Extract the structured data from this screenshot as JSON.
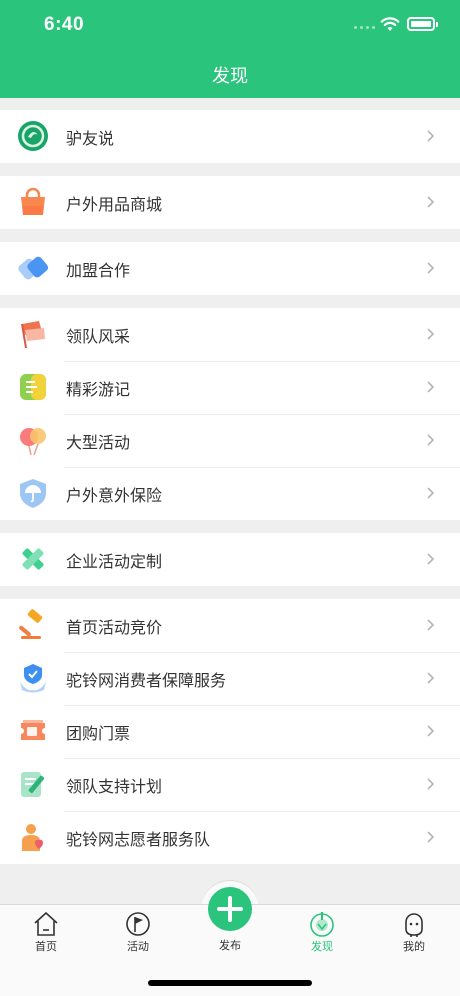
{
  "status": {
    "time": "6:40"
  },
  "header": {
    "title": "发现"
  },
  "sections": [
    {
      "items": [
        {
          "label": "驴友说",
          "icon": "lvyoushuo-icon"
        }
      ]
    },
    {
      "items": [
        {
          "label": "户外用品商城",
          "icon": "shopping-bag-icon"
        }
      ]
    },
    {
      "items": [
        {
          "label": "加盟合作",
          "icon": "join-icon"
        }
      ]
    },
    {
      "items": [
        {
          "label": "领队风采",
          "icon": "flag-icon"
        },
        {
          "label": "精彩游记",
          "icon": "notes-icon"
        },
        {
          "label": "大型活动",
          "icon": "balloon-icon"
        },
        {
          "label": "户外意外保险",
          "icon": "umbrella-shield-icon"
        }
      ]
    },
    {
      "items": [
        {
          "label": "企业活动定制",
          "icon": "pencil-ruler-icon"
        }
      ]
    },
    {
      "items": [
        {
          "label": "首页活动竞价",
          "icon": "gavel-icon"
        },
        {
          "label": "驼铃网消费者保障服务",
          "icon": "shield-hand-icon"
        },
        {
          "label": "团购门票",
          "icon": "ticket-icon"
        },
        {
          "label": "领队支持计划",
          "icon": "document-edit-icon"
        },
        {
          "label": "驼铃网志愿者服务队",
          "icon": "volunteer-icon"
        }
      ]
    }
  ],
  "tabbar": {
    "home": "首页",
    "activity": "活动",
    "publish": "发布",
    "discover": "发现",
    "mine": "我的"
  },
  "colors": {
    "brand": "#2bc47d",
    "background": "#efefef"
  }
}
